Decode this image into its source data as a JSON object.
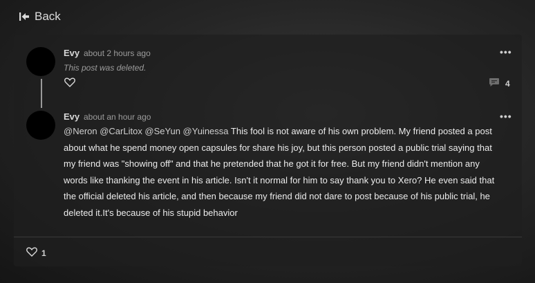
{
  "nav": {
    "back_label": "Back"
  },
  "comments": [
    {
      "author": "Evy",
      "time": "about 2 hours ago",
      "deleted_text": "This post was deleted.",
      "reply_count": "4"
    },
    {
      "author": "Evy",
      "time": "about an hour ago",
      "mentions": "@Neron @CarLitox @SeYun @Yuinessa",
      "body": "This fool is not aware of his own problem. My friend posted a post about what he spend money open capsules for share his joy, but this person posted a public trial saying that my friend was \"showing off\" and that he pretended that he got it for free. But my friend didn't mention any words like thanking the event in his article. Isn't it normal for him to say thank you to Xero? He even said that the official deleted his article, and then because my friend did not dare to post because of his public trial, he deleted it.It's because of his stupid behavior"
    }
  ],
  "footer": {
    "like_count": "1"
  },
  "icons": {
    "back": "back-arrow-icon",
    "like": "heart-icon",
    "reply": "comment-bubble-icon",
    "more": "more-dots-icon"
  }
}
